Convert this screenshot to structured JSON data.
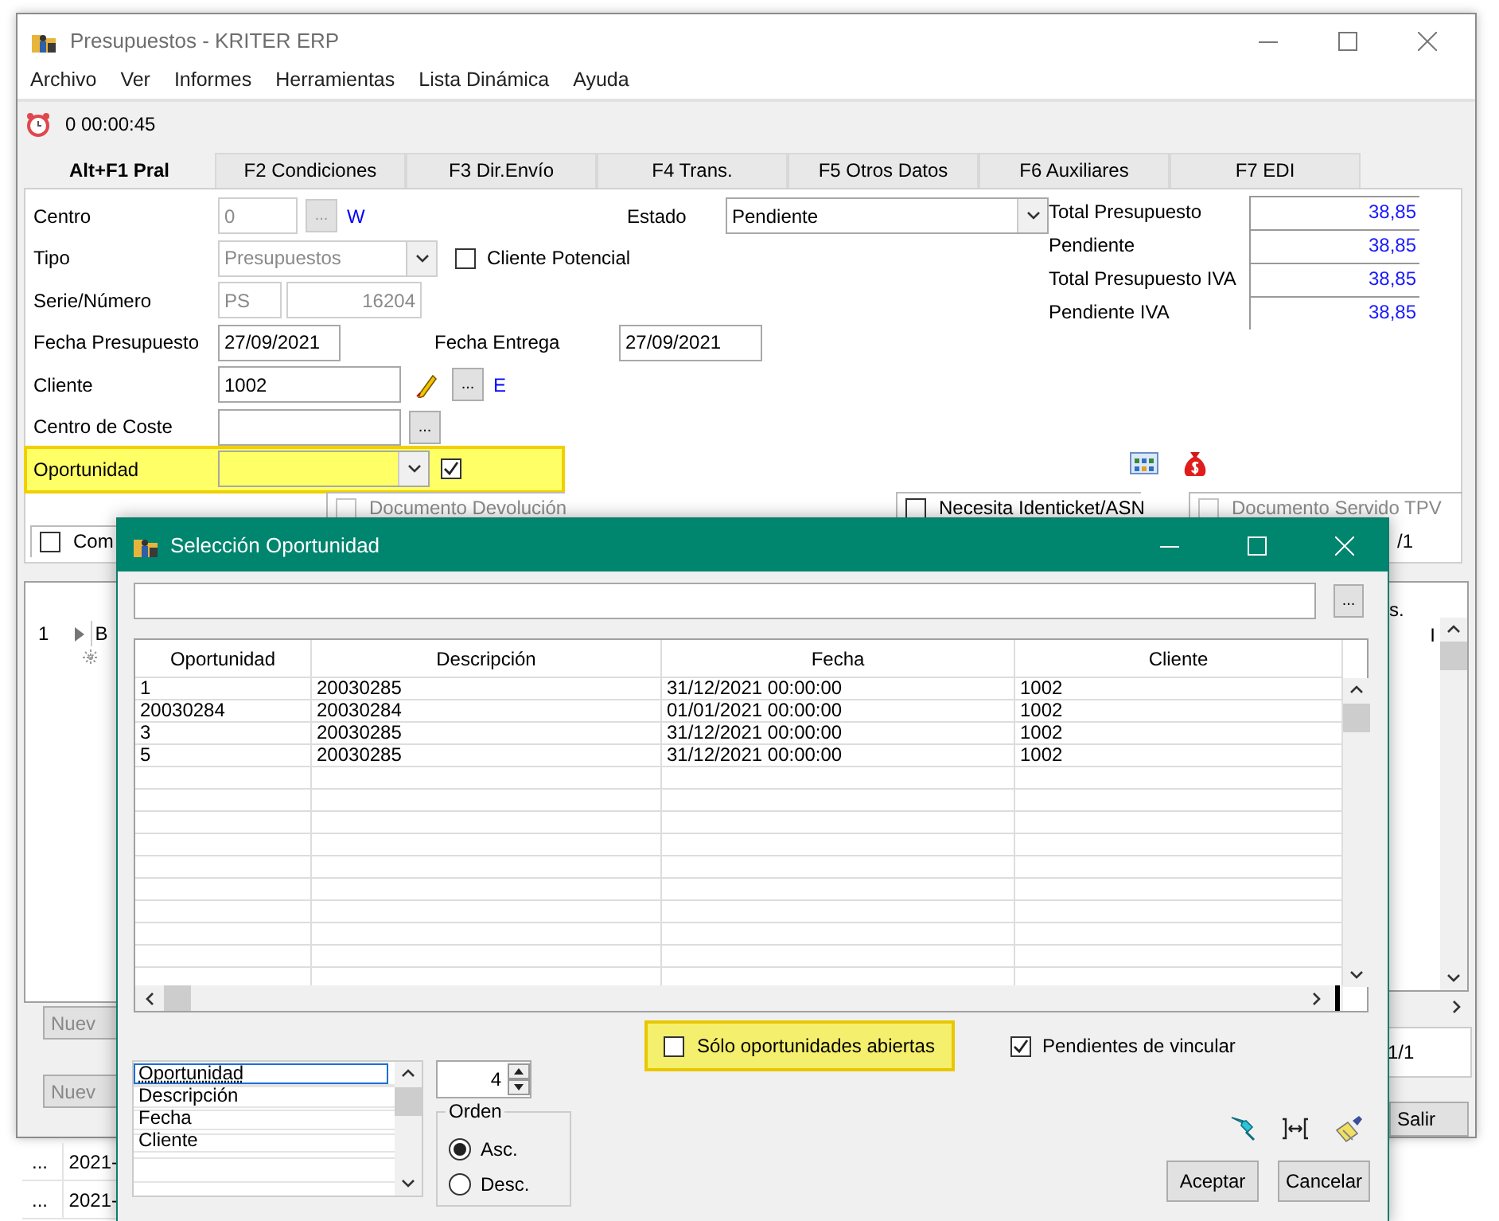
{
  "window": {
    "title": "Presupuestos - KRITER ERP"
  },
  "menu": [
    "Archivo",
    "Ver",
    "Informes",
    "Herramientas",
    "Lista Dinámica",
    "Ayuda"
  ],
  "timer": "0 00:00:45",
  "tabs": [
    {
      "label": "Alt+F1 Pral",
      "selected": true
    },
    {
      "label": "F2 Condiciones",
      "selected": false
    },
    {
      "label": "F3 Dir.Envío",
      "selected": false
    },
    {
      "label": "F4 Trans.",
      "selected": false
    },
    {
      "label": "F5 Otros Datos",
      "selected": false
    },
    {
      "label": "F6 Auxiliares",
      "selected": false
    },
    {
      "label": "F7 EDI",
      "selected": false
    }
  ],
  "form": {
    "centro": {
      "label": "Centro",
      "value": "0",
      "disabled": true,
      "browse_button": "...",
      "link": "W"
    },
    "estado": {
      "label": "Estado",
      "value": "Pendiente"
    },
    "tipo": {
      "label": "Tipo",
      "value": "Presupuestos",
      "disabled": true
    },
    "cliente_potencial": {
      "label": "Cliente Potencial",
      "checked": false
    },
    "serie_numero": {
      "label": "Serie/Número",
      "serie": "PS",
      "numero": "16204",
      "disabled": true
    },
    "fecha_presupuesto": {
      "label": "Fecha Presupuesto",
      "value": "27/09/2021"
    },
    "fecha_entrega": {
      "label": "Fecha Entrega",
      "value": "27/09/2021"
    },
    "cliente": {
      "label": "Cliente",
      "value": "1002",
      "browse_button": "...",
      "link": "E"
    },
    "centro_coste": {
      "label": "Centro de Coste",
      "browse_button": "..."
    },
    "oportunidad": {
      "label": "Oportunidad",
      "highlighted": true,
      "checked": true
    }
  },
  "totals": [
    {
      "label": "Total Presupuesto",
      "value": "38,85"
    },
    {
      "label": "Pendiente",
      "value": "38,85"
    },
    {
      "label": "Total Presupuesto IVA",
      "value": "38,85"
    },
    {
      "label": "Pendiente IVA",
      "value": "38,85"
    }
  ],
  "options": [
    {
      "label": "Documento Devolución",
      "checked": false,
      "disabled": true
    },
    {
      "label": "Necesita Identicket/ASN",
      "checked": false,
      "disabled": false
    },
    {
      "label": "Documento Servido TPV",
      "checked": false,
      "disabled": true
    }
  ],
  "com_option": {
    "label": "Com",
    "checked": false
  },
  "page_top": "/1",
  "lines_grid": {
    "row_number": "1",
    "cell": "B"
  },
  "left_buttons": [
    "Nuev",
    "Nuev"
  ],
  "right_grid": {
    "column_1": "s.",
    "column_2": "I"
  },
  "page": "1/1",
  "exit_button": "Salir",
  "back_rows": [
    {
      "column_1": "...",
      "column_2": "2021-"
    },
    {
      "column_1": "...",
      "column_2": "2021-"
    }
  ],
  "dialog": {
    "title": "Selección Oportunidad",
    "search_button": "...",
    "table": {
      "columns": [
        "Oportunidad",
        "Descripción",
        "Fecha",
        "Cliente"
      ],
      "rows": [
        [
          "1",
          "20030285",
          "31/12/2021 00:00:00",
          "1002"
        ],
        [
          "20030284",
          "20030284",
          "01/01/2021 00:00:00",
          "1002"
        ],
        [
          "3",
          "20030285",
          "31/12/2021 00:00:00",
          "1002"
        ],
        [
          "5",
          "20030285",
          "31/12/2021 00:00:00",
          "1002"
        ]
      ]
    },
    "only_open": {
      "label": "Sólo oportunidades abiertas",
      "checked": false,
      "highlighted": true
    },
    "pending_link": {
      "label": "Pendientes de vincular",
      "checked": true
    },
    "sort_fields": [
      {
        "label": "Oportunidad",
        "selected": true
      },
      {
        "label": "Descripción",
        "selected": false
      },
      {
        "label": "Fecha",
        "selected": false
      },
      {
        "label": "Cliente",
        "selected": false
      }
    ],
    "count": "4",
    "order": {
      "label": "Orden",
      "options": [
        {
          "label": "Asc.",
          "selected": true
        },
        {
          "label": "Desc.",
          "selected": false
        }
      ]
    },
    "buttons": [
      "Aceptar",
      "Cancelar"
    ]
  }
}
